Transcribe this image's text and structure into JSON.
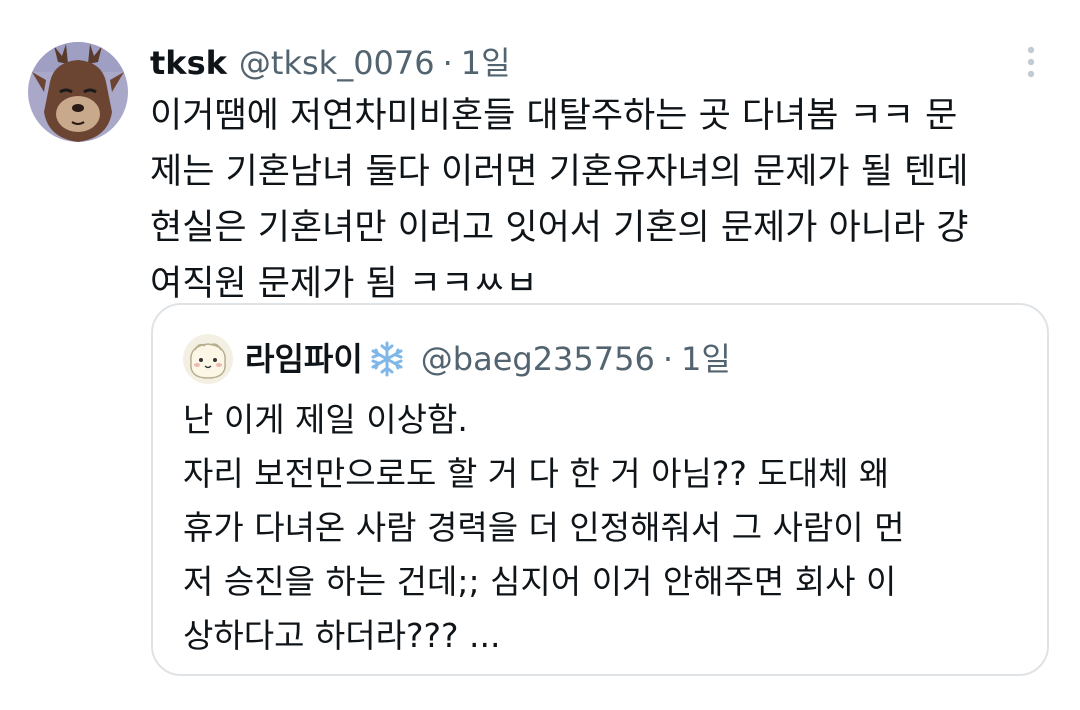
{
  "tweet": {
    "display_name": "tksk",
    "handle": "@tksk_0076",
    "separator": "·",
    "time": "1일",
    "text_lines": [
      "이거땜에 저연차미비혼들 대탈주하는 곳 다녀봄 ㅋㅋ 문",
      "제는 기혼남녀 둘다 이러면 기혼유자녀의 문제가 될 텐데",
      "현실은 기혼녀만 이러고 잇어서 기혼의 문제가 아니라 걍",
      "여직원 문제가 됨 ㅋㅋㅆㅂ"
    ]
  },
  "quoted_tweet": {
    "display_name": "라임파이",
    "emoji": "❄️",
    "handle": "@baeg235756",
    "separator": "·",
    "time": "1일",
    "text_lines": [
      "난 이게 제일 이상함.",
      "자리 보전만으로도 할 거 다 한 거 아님?? 도대체 왜",
      "휴가 다녀온 사람 경력을 더 인정해줘서 그 사람이 먼",
      "저 승진을 하는 건데;; 심지어 이거 안해주면 회사 이",
      "상하다고 하더라??? ..."
    ]
  },
  "icons": {
    "more": "more-vertical-icon",
    "avatar": "user-avatar",
    "snowflake": "snowflake-emoji"
  },
  "colors": {
    "text_primary": "#0f1419",
    "text_secondary": "#536471",
    "border": "#dfe3e6",
    "snowflake": "#7fb8e8"
  }
}
